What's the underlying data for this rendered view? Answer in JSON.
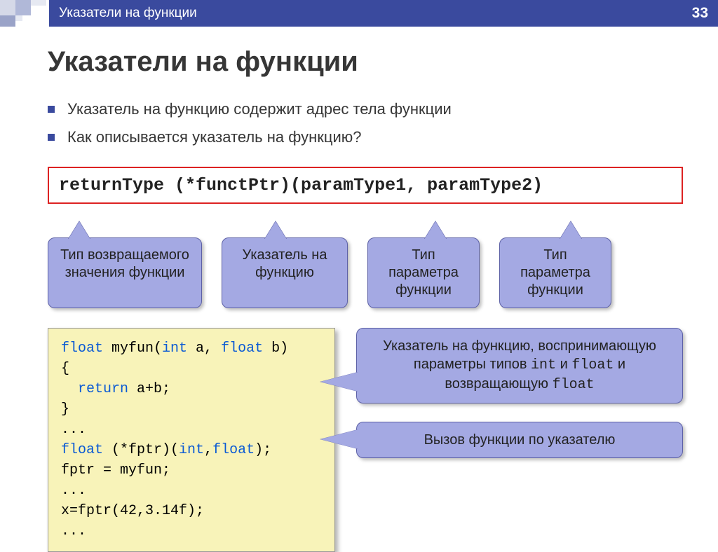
{
  "header": {
    "title": "Указатели на функции",
    "page_number": "33"
  },
  "heading": "Указатели на функции",
  "bullets": [
    "Указатель на функцию содержит адрес тела функции",
    "Как описывается указатель на функцию?"
  ],
  "syntax": "returnType  (*functPtr)(paramType1, paramType2)",
  "callouts": {
    "c1": "Тип возвращаемого значения функции",
    "c2": "Указатель на функцию",
    "c3": "Тип параметра функции",
    "c4": "Тип параметра функции"
  },
  "code": {
    "l1a": "float",
    "l1b": " myfun(",
    "l1c": "int",
    "l1d": " a, ",
    "l1e": "float",
    "l1f": " b)",
    "l2": "{",
    "l3a": "  return",
    "l3b": " a+b;",
    "l4": "}",
    "l5": "...",
    "l6a": "float",
    "l6b": " (*fptr)(",
    "l6c": "int",
    "l6d": ",",
    "l6e": "float",
    "l6f": ");",
    "l7": "fptr = myfun;",
    "l8": "...",
    "l9": "x=fptr(42,3.14f);",
    "l10": "..."
  },
  "right_callouts": {
    "r1_pre": "Указатель на функцию, воспринимающую параметры типов ",
    "r1_t1": "int",
    "r1_mid1": " и ",
    "r1_t2": "float",
    "r1_mid2": " и возвращающую ",
    "r1_t3": "float",
    "r2": "Вызов функции по указателю"
  }
}
